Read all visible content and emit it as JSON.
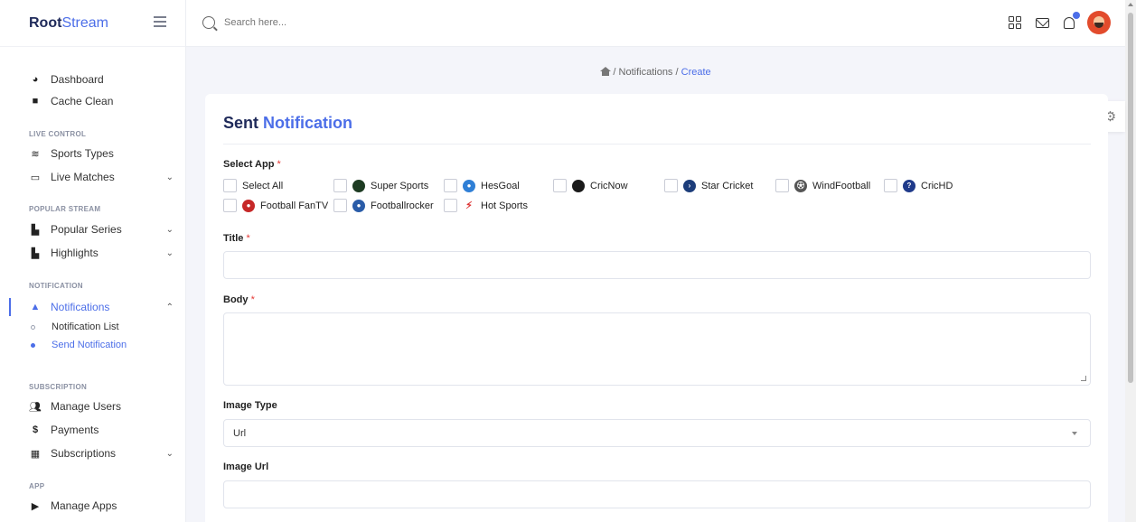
{
  "brand": {
    "bold": "Root",
    "light": "Stream"
  },
  "search": {
    "placeholder": "Search here..."
  },
  "sidebar": {
    "items": [
      {
        "label": "Dashboard",
        "icon": "dashboard-icon"
      },
      {
        "label": "Cache Clean",
        "icon": "trash-icon"
      },
      {
        "section": "LIVE CONTROL"
      },
      {
        "label": "Sports Types",
        "icon": "layers-icon"
      },
      {
        "label": "Live Matches",
        "icon": "monitor-icon"
      },
      {
        "section": "POPULAR STREAM"
      },
      {
        "label": "Popular Series",
        "icon": "file-icon"
      },
      {
        "label": "Highlights",
        "icon": "file-icon"
      },
      {
        "section": "NOTIFICATION"
      },
      {
        "label": "Notifications",
        "icon": "bell-icon"
      },
      {
        "sub": "Notification List"
      },
      {
        "sub": "Send Notification"
      },
      {
        "section": "SUBSCRIPTION"
      },
      {
        "label": "Manage Users",
        "icon": "users-icon"
      },
      {
        "label": "Payments",
        "icon": "dollar-icon"
      },
      {
        "label": "Subscriptions",
        "icon": "grid-icon"
      },
      {
        "section": "APP"
      },
      {
        "label": "Manage Apps",
        "icon": "play-icon"
      }
    ]
  },
  "breadcrumb": {
    "sep": "/",
    "notifications": "Notifications",
    "current": "Create"
  },
  "form": {
    "title_plain": "Sent",
    "title_accent": "Notification",
    "select_app_label": "Select App",
    "required_mark": "*",
    "apps": [
      "Select All",
      "Super Sports",
      "HesGoal",
      "CricNow",
      "Star Cricket",
      "WindFootball",
      "CricHD",
      "Football FanTV",
      "Footballrocker",
      "Hot Sports"
    ],
    "title_label": "Title",
    "body_label": "Body",
    "image_type_label": "Image Type",
    "image_type_value": "Url",
    "image_url_label": "Image Url"
  },
  "colors": {
    "accent": "#4c6ee8",
    "navy": "#1f2a5a",
    "required": "#e53935"
  }
}
